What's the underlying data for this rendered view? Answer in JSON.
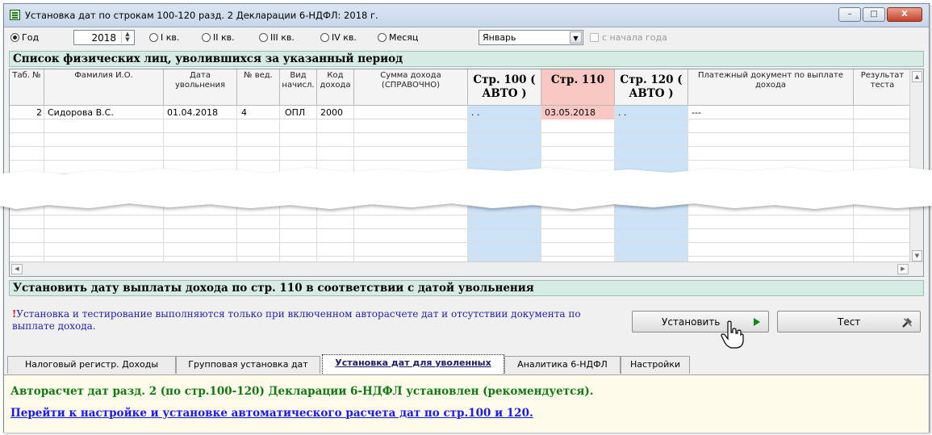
{
  "window": {
    "title": "Установка дат по строкам 100-120 разд. 2 Декларации 6-НДФЛ: 2018 г.",
    "controls": {
      "minimize": "–",
      "maximize": "□",
      "close": "X"
    }
  },
  "toolbar": {
    "period_options": [
      {
        "label": "Год",
        "selected": true
      },
      {
        "label": "I кв.",
        "selected": false
      },
      {
        "label": "II кв.",
        "selected": false
      },
      {
        "label": "III кв.",
        "selected": false
      },
      {
        "label": "IV кв.",
        "selected": false
      },
      {
        "label": "Месяц",
        "selected": false
      }
    ],
    "year_value": "2018",
    "month_value": "Январь",
    "from_year_start_label": "с начала года"
  },
  "list_section": {
    "title": "Список физических лиц, уволившихся за указанный период"
  },
  "grid": {
    "columns": [
      {
        "label": "Таб. №"
      },
      {
        "label": "Фамилия И.О."
      },
      {
        "label": "Дата увольнения"
      },
      {
        "label": "№ вед."
      },
      {
        "label": "Вид начисл."
      },
      {
        "label": "Код дохода"
      },
      {
        "label": "Сумма дохода (СПРАВОЧНО)"
      },
      {
        "label": "Стр. 100 ( АВТО )"
      },
      {
        "label": "Стр. 110"
      },
      {
        "label": "Стр. 120 ( АВТО )"
      },
      {
        "label": "Платежный документ по выплате дохода"
      },
      {
        "label": "Результат теста"
      }
    ],
    "rows": [
      {
        "tab_no": "2",
        "name": "Сидорова В.С.",
        "dismissal_date": "01.04.2018",
        "sheet_no": "4",
        "accrual_type": "ОПЛ",
        "income_code": "2000",
        "income_sum": "",
        "line100": ". .",
        "line110": "03.05.2018",
        "line120": ". .",
        "payment_doc": "---",
        "test_result": ""
      }
    ]
  },
  "set_section": {
    "title": "Установить дату выплаты дохода по стр. 110 в соответствии с датой увольнения",
    "warning_mark": "!",
    "warning_text": "Установка и тестирование выполняются только при включенном авторасчете дат и отсутствии документа по выплате дохода."
  },
  "buttons": {
    "set_label": "Установить",
    "test_label": "Тест"
  },
  "tabs": [
    {
      "label": "Налоговый регистр. Доходы",
      "active": false
    },
    {
      "label": "Групповая установка дат",
      "active": false
    },
    {
      "label": "Установка дат для уволенных",
      "active": true
    },
    {
      "label": "Аналитика 6-НДФЛ",
      "active": false
    },
    {
      "label": "Настройки",
      "active": false
    }
  ],
  "bottom": {
    "status": "Авторасчет дат разд. 2 (по стр.100-120) Декларации 6-НДФЛ установлен (рекомендуется).",
    "link": "Перейти к настройке и установке автоматического расчета дат по стр.100 и 120."
  },
  "colors": {
    "section_bg": "#d6ebe4",
    "auto_column": "#cce2f6",
    "line110": "#f9c8c3",
    "status_green": "#117711",
    "link_blue": "#1a1aee",
    "warning_blue": "#2222aa"
  }
}
